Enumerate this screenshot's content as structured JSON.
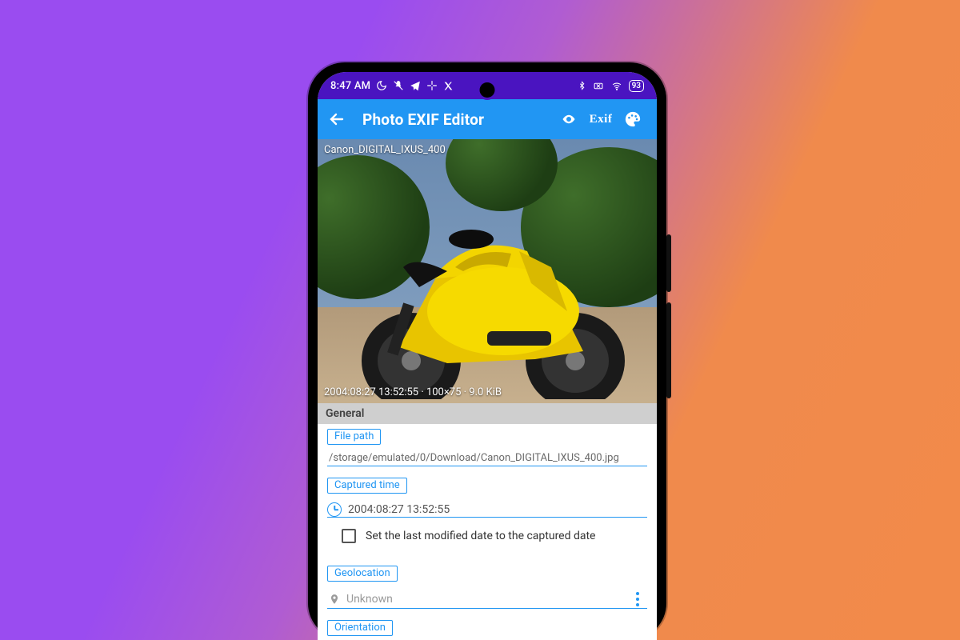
{
  "status": {
    "time": "8:47 AM",
    "battery": "93"
  },
  "appbar": {
    "title": "Photo EXIF Editor",
    "actions": {
      "view": "view-icon",
      "exif": "Exif",
      "palette": "palette-icon"
    }
  },
  "image": {
    "filename_overlay": "Canon_DIGITAL_IXUS_400",
    "meta_overlay": "2004:08:27 13:52:55 · 100×75 · 9.0 KiB"
  },
  "sections": {
    "general": {
      "label": "General",
      "file_path_label": "File path",
      "file_path_value": "/storage/emulated/0/Download/Canon_DIGITAL_IXUS_400.jpg",
      "captured_time_label": "Captured time",
      "captured_time_value": "2004:08:27 13:52:55",
      "checkbox_label": "Set the last modified date to the captured date",
      "geolocation_label": "Geolocation",
      "geolocation_value": "Unknown",
      "orientation_label": "Orientation"
    }
  }
}
